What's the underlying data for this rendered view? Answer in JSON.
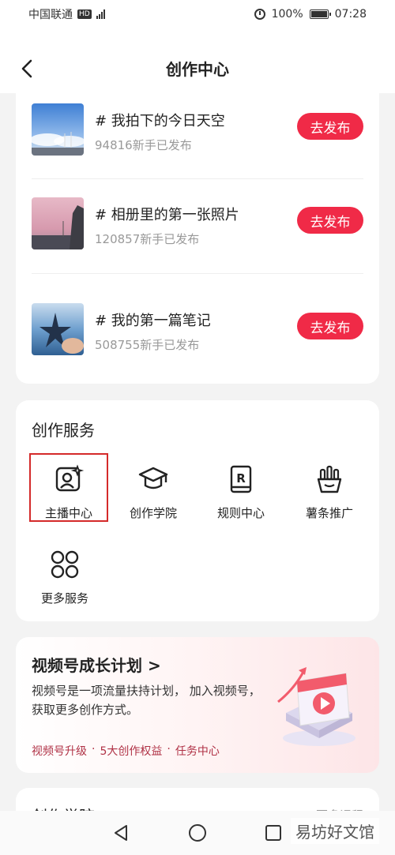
{
  "status_bar": {
    "carrier": "中国联通",
    "network_badge": "HD",
    "battery": "100%",
    "time": "07:28"
  },
  "header": {
    "title": "创作中心",
    "back_icon": "chevron-left-icon"
  },
  "topics": [
    {
      "title": "# 我拍下的今日天空",
      "subtitle": "94816新手已发布",
      "button": "去发布",
      "thumb": "sky-photo"
    },
    {
      "title": "# 相册里的第一张照片",
      "subtitle": "120857新手已发布",
      "button": "去发布",
      "thumb": "pink-sky-photo"
    },
    {
      "title": "# 我的第一篇笔记",
      "subtitle": "508755新手已发布",
      "button": "去发布",
      "thumb": "starfish-photo"
    }
  ],
  "services": {
    "title": "创作服务",
    "items": [
      {
        "label": "主播中心",
        "icon": "anchor-profile-icon"
      },
      {
        "label": "创作学院",
        "icon": "graduation-cap-icon"
      },
      {
        "label": "规则中心",
        "icon": "rulebook-icon"
      },
      {
        "label": "薯条推广",
        "icon": "fries-icon"
      },
      {
        "label": "更多服务",
        "icon": "grid-circles-icon"
      }
    ]
  },
  "growth": {
    "title": "视频号成长计划 >",
    "desc": "视频号是一项流量扶持计划， 加入视频号，获取更多创作方式。",
    "links": [
      "视频号升级",
      "·",
      "5大创作权益",
      "·",
      "任务中心"
    ]
  },
  "academy": {
    "title": "创作学院",
    "more": "更多课程"
  },
  "watermark": "易坊好文馆",
  "colors": {
    "accent": "#f02a47",
    "highlight": "#d42a2a",
    "link": "#b03246"
  }
}
